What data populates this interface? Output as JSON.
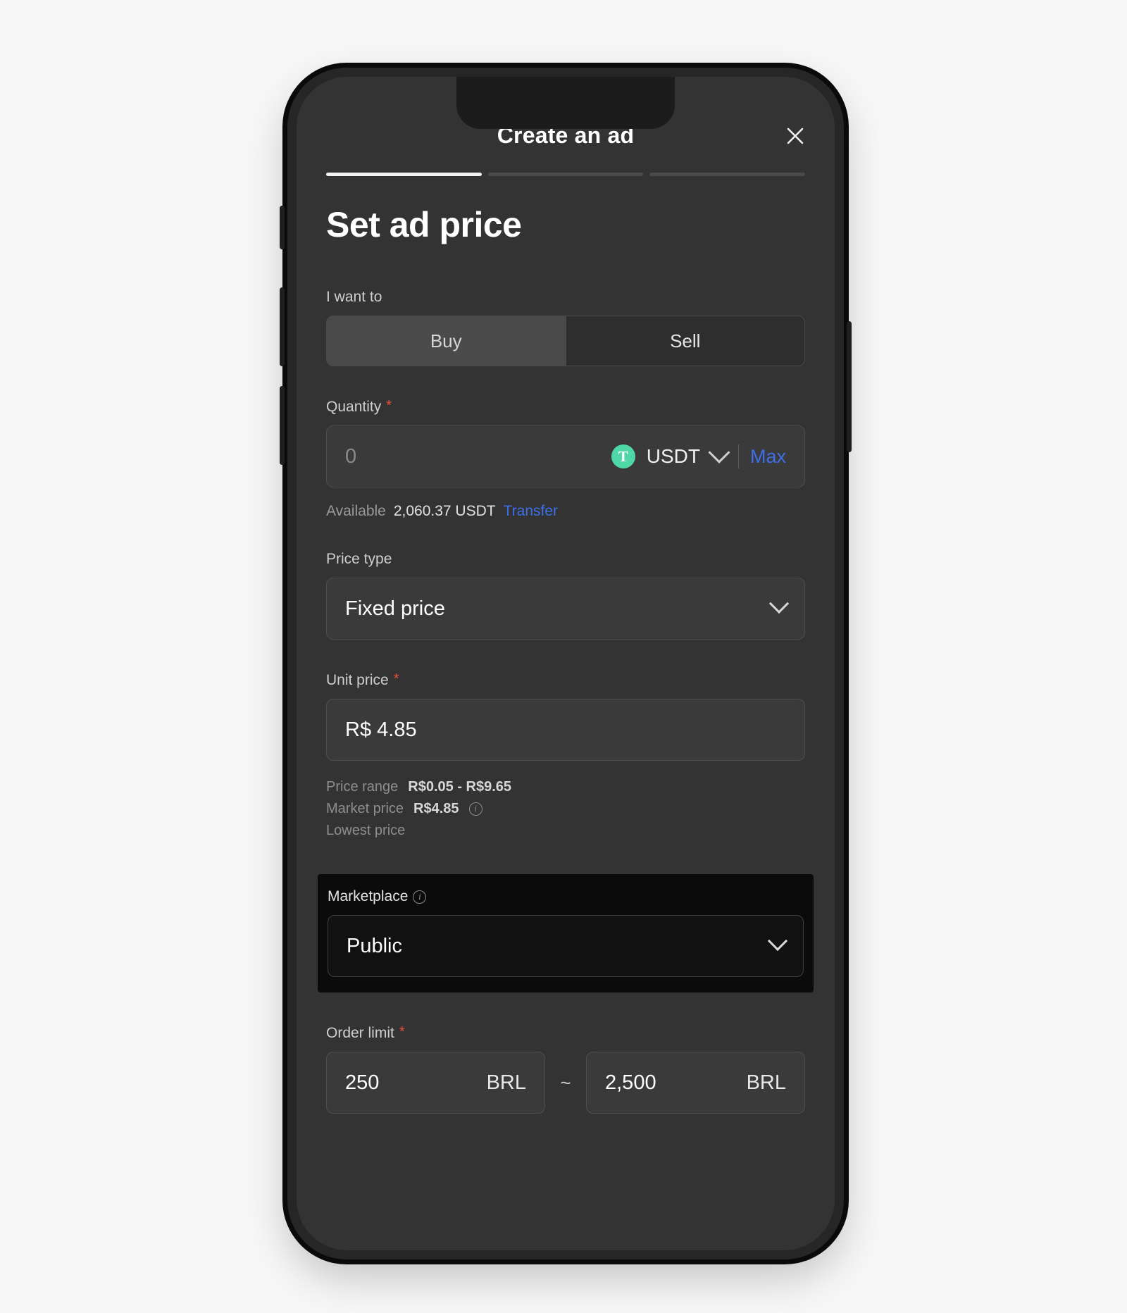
{
  "header": {
    "title": "Create an ad",
    "close_icon": "close-icon"
  },
  "steps": {
    "total": 3,
    "active_index": 0
  },
  "page": {
    "title": "Set ad price"
  },
  "side_label": {
    "i_want_to": "I want to"
  },
  "segmented": {
    "options": [
      {
        "label": "Buy",
        "active": true
      },
      {
        "label": "Sell",
        "active": false
      }
    ]
  },
  "quantity": {
    "label": "Quantity",
    "required": "*",
    "placeholder": "0",
    "value": "",
    "coin_glyph": "T",
    "coin_symbol": "USDT",
    "chevron_icon": "chevron-down-icon",
    "max_label": "Max",
    "available_label": "Available",
    "available_amount": "2,060.37 USDT",
    "transfer_label": "Transfer"
  },
  "price_type": {
    "label": "Price type",
    "value": "Fixed price",
    "chevron_icon": "chevron-down-icon"
  },
  "unit_price": {
    "label": "Unit price",
    "required": "*",
    "value": "R$ 4.85"
  },
  "price_meta": {
    "range_key": "Price range",
    "range_val": "R$0.05 - R$9.65",
    "market_key": "Market price",
    "market_val": "R$4.85",
    "info_icon": "info-icon",
    "lowest_key": "Lowest price"
  },
  "marketplace": {
    "label": "Marketplace",
    "info_icon": "info-icon",
    "value": "Public",
    "chevron_icon": "chevron-down-icon"
  },
  "order_limit": {
    "label": "Order limit",
    "required": "*",
    "min_value": "250",
    "min_currency": "BRL",
    "separator": "~",
    "max_value": "2,500",
    "max_currency": "BRL"
  },
  "colors": {
    "accent_blue": "#3e6fe8",
    "required_red": "#e8503a",
    "usdt_green": "#4fd7a8",
    "screen_bg": "#333333",
    "highlight_bg": "#0b0b0b"
  }
}
